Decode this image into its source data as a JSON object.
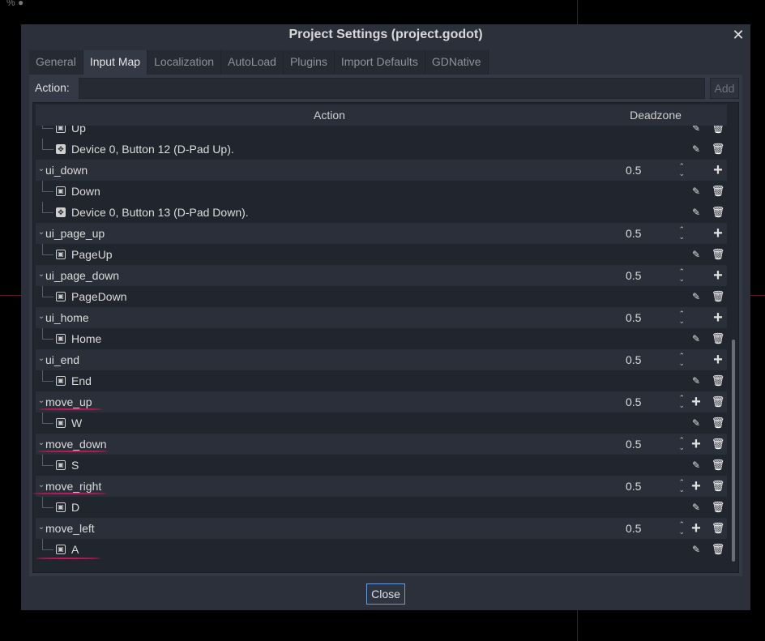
{
  "window": {
    "title": "Project Settings (project.godot)"
  },
  "tabs": [
    {
      "label": "General",
      "active": false
    },
    {
      "label": "Input Map",
      "active": true
    },
    {
      "label": "Localization",
      "active": false
    },
    {
      "label": "AutoLoad",
      "active": false
    },
    {
      "label": "Plugins",
      "active": false
    },
    {
      "label": "Import Defaults",
      "active": false
    },
    {
      "label": "GDNative",
      "active": false
    }
  ],
  "action_bar": {
    "label": "Action:",
    "input_value": "",
    "add_label": "Add"
  },
  "tree": {
    "header": {
      "action": "Action",
      "deadzone": "Deadzone"
    },
    "rows": [
      {
        "kind": "event",
        "icon": "key",
        "label": "Up"
      },
      {
        "kind": "event",
        "icon": "joypad",
        "label": "Device 0, Button 12 (D-Pad Up)."
      },
      {
        "kind": "action",
        "name": "ui_down",
        "deadzone": "0.5",
        "deletable": false
      },
      {
        "kind": "event",
        "icon": "key",
        "label": "Down"
      },
      {
        "kind": "event",
        "icon": "joypad",
        "label": "Device 0, Button 13 (D-Pad Down)."
      },
      {
        "kind": "action",
        "name": "ui_page_up",
        "deadzone": "0.5",
        "deletable": false
      },
      {
        "kind": "event",
        "icon": "key",
        "label": "PageUp"
      },
      {
        "kind": "action",
        "name": "ui_page_down",
        "deadzone": "0.5",
        "deletable": false
      },
      {
        "kind": "event",
        "icon": "key",
        "label": "PageDown"
      },
      {
        "kind": "action",
        "name": "ui_home",
        "deadzone": "0.5",
        "deletable": false
      },
      {
        "kind": "event",
        "icon": "key",
        "label": "Home"
      },
      {
        "kind": "action",
        "name": "ui_end",
        "deadzone": "0.5",
        "deletable": false
      },
      {
        "kind": "event",
        "icon": "key",
        "label": "End"
      },
      {
        "kind": "action",
        "name": "move_up",
        "deadzone": "0.5",
        "deletable": true
      },
      {
        "kind": "event",
        "icon": "key",
        "label": "W"
      },
      {
        "kind": "action",
        "name": "move_down",
        "deadzone": "0.5",
        "deletable": true
      },
      {
        "kind": "event",
        "icon": "key",
        "label": "S"
      },
      {
        "kind": "action",
        "name": "move_right",
        "deadzone": "0.5",
        "deletable": true
      },
      {
        "kind": "event",
        "icon": "key",
        "label": "D"
      },
      {
        "kind": "action",
        "name": "move_left",
        "deadzone": "0.5",
        "deletable": true
      },
      {
        "kind": "event",
        "icon": "key",
        "label": "A"
      }
    ]
  },
  "footer": {
    "close_label": "Close"
  },
  "colors": {
    "annotation": "#c2185b",
    "focus_border": "#6b9bd6"
  }
}
